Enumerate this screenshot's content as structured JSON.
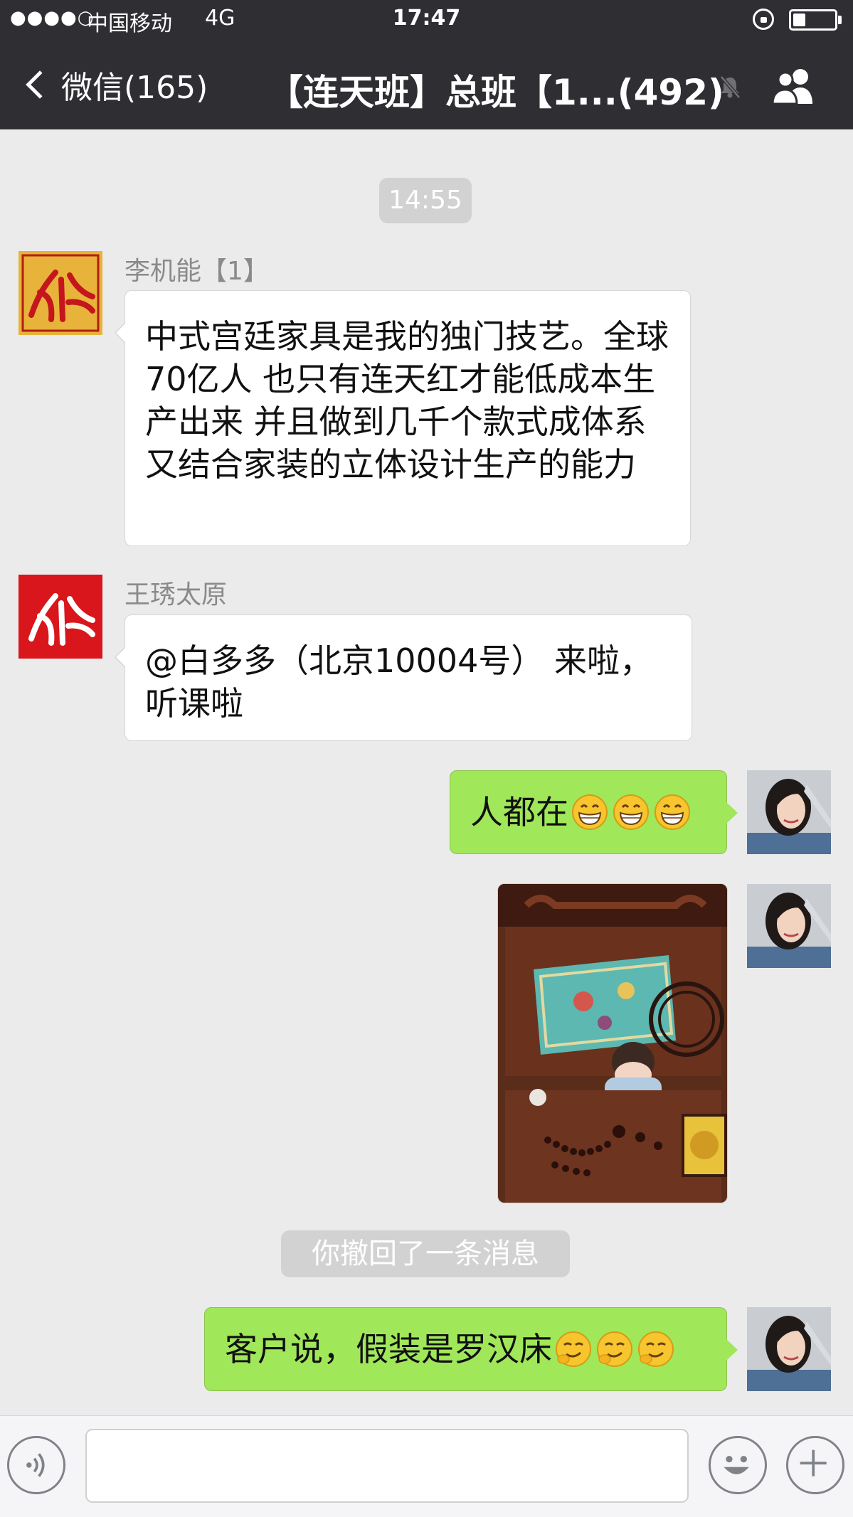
{
  "status_bar": {
    "signal": "●●●●○",
    "carrier": "中国移动",
    "network": "4G",
    "time": "17:47",
    "battery_level": 0.3
  },
  "nav": {
    "back_label": "微信(165)",
    "title": "【连天班】总班【1...(492)"
  },
  "timestamp": "14:55",
  "messages": [
    {
      "sender": "李机能【1】",
      "text": "中式宫廷家具是我的独门技艺。全球70亿人 也只有连天红才能低成本生产出来 并且做到几千个款式成体系又结合家装的立体设计生产的能力"
    },
    {
      "sender": "王琇太原",
      "text": "@白多多（北京10004号） 来啦，听课啦"
    },
    {
      "text": "人都在",
      "emoji": [
        "grin-icon",
        "grin-icon",
        "grin-icon"
      ]
    },
    {
      "type": "image"
    },
    {
      "text": "客户说，假装是罗汉床",
      "emoji": [
        "sly-smile-icon",
        "sly-smile-icon",
        "sly-smile-icon"
      ]
    }
  ],
  "recall_notice": "你撤回了一条消息",
  "colors": {
    "header_bg": "#2e2e33",
    "chat_bg": "#ebebeb",
    "outgoing_bubble": "#a0e75a",
    "incoming_bubble": "#ffffff",
    "brand_red": "#e0201f"
  },
  "icons": {
    "back": "chevron-left-icon",
    "mute": "bell-muted-icon",
    "members": "group-icon",
    "voice": "voice-icon",
    "emoji": "smiley-icon",
    "plus": "plus-icon"
  }
}
